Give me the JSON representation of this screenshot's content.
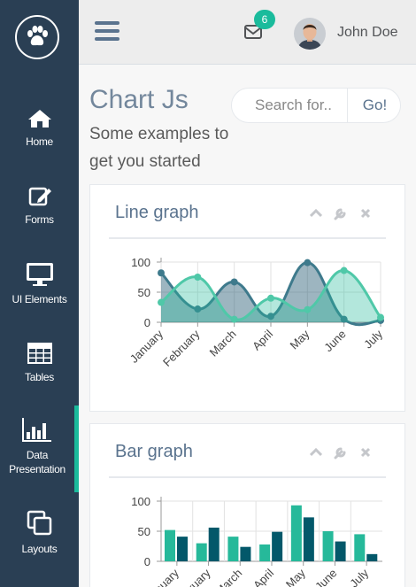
{
  "sidebar": {
    "logo_icon": "paw-icon",
    "items": [
      {
        "label": "Home",
        "icon": "home-icon"
      },
      {
        "label": "Forms",
        "icon": "edit-icon"
      },
      {
        "label": "UI Elements",
        "icon": "monitor-icon"
      },
      {
        "label": "Tables",
        "icon": "table-icon"
      },
      {
        "label": "Data\nPresentation",
        "icon": "bar-chart-icon",
        "active": true
      },
      {
        "label": "Layouts",
        "icon": "clone-icon"
      }
    ]
  },
  "topbar": {
    "menu_icon": "menu-icon",
    "mail_icon": "envelope-icon",
    "mail_count": "6",
    "user_name": "John Doe"
  },
  "page": {
    "title": "Chart Js",
    "subtitle": "Some examples to get you started",
    "search_placeholder": "Search for..",
    "search_button": "Go!"
  },
  "colors": {
    "sidebar_bg": "#2a3f54",
    "accent": "#1abb9c",
    "series_dark": "#3e7a8c",
    "series_light": "#4fc8a8",
    "bar_light": "#26b99a",
    "bar_dark": "#03586a"
  },
  "panels": {
    "line": {
      "title": "Line graph"
    },
    "bar": {
      "title": "Bar graph"
    }
  },
  "chart_data": [
    {
      "type": "line",
      "categories": [
        "January",
        "February",
        "March",
        "April",
        "May",
        "June",
        "July"
      ],
      "series": [
        {
          "values": [
            82,
            22,
            67,
            10,
            99,
            5,
            3
          ]
        },
        {
          "values": [
            33,
            75,
            5,
            40,
            21,
            86,
            8
          ]
        }
      ],
      "yticks": [
        0,
        50,
        100
      ],
      "ylim": [
        0,
        100
      ],
      "grid": true
    },
    {
      "type": "bar",
      "categories": [
        "January",
        "February",
        "March",
        "April",
        "May",
        "June",
        "July"
      ],
      "series": [
        {
          "values": [
            52,
            30,
            41,
            28,
            93,
            50,
            45
          ]
        },
        {
          "values": [
            41,
            56,
            24,
            49,
            73,
            33,
            12
          ]
        }
      ],
      "yticks": [
        0,
        50,
        100
      ],
      "ylim": [
        0,
        100
      ],
      "grid": true
    }
  ]
}
